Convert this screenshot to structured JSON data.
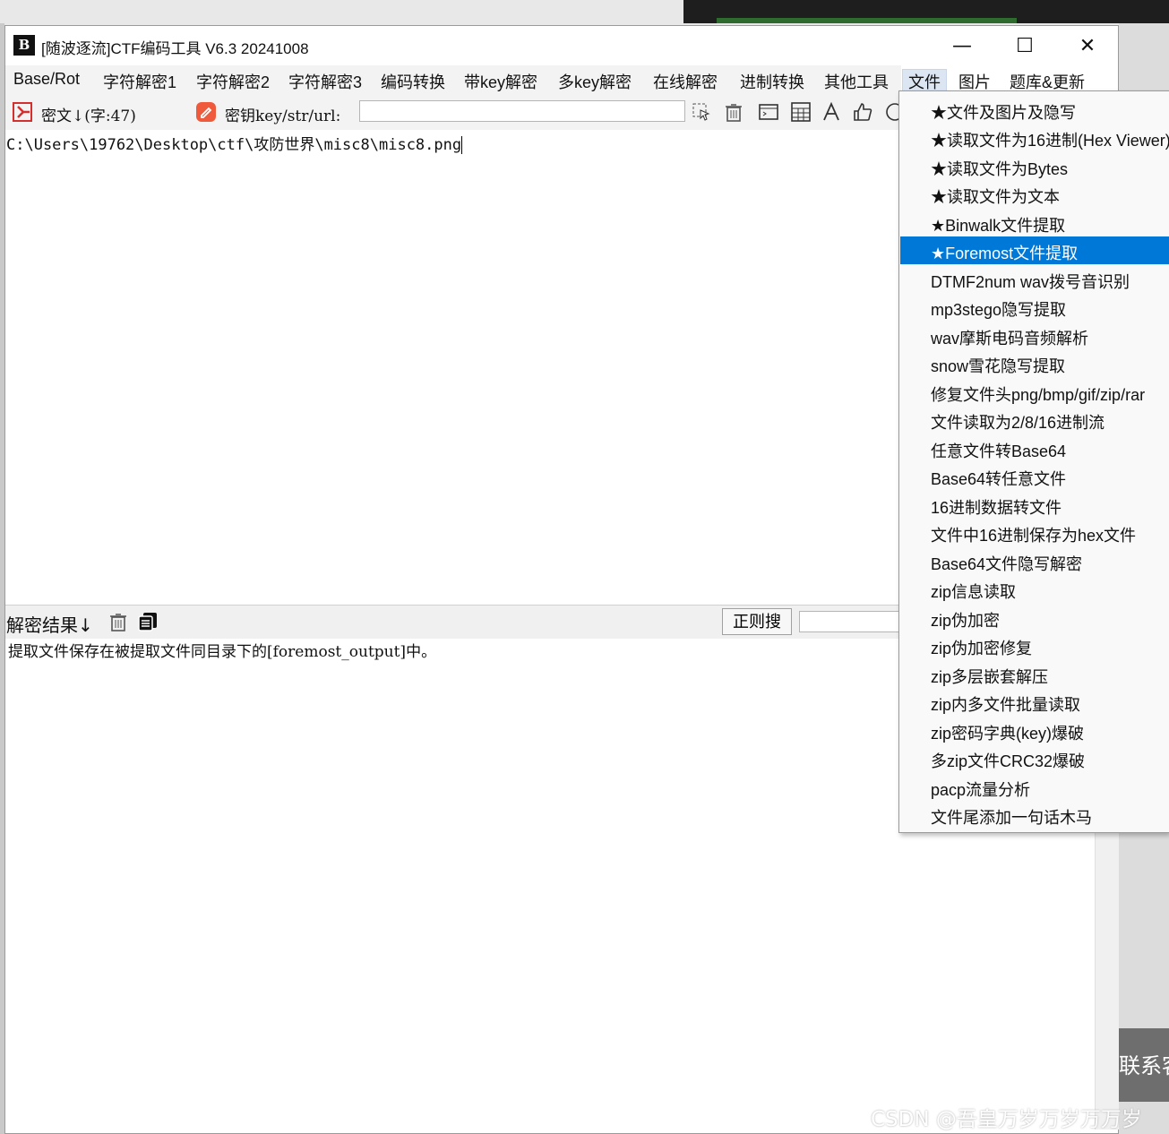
{
  "window": {
    "title": "[随波逐流]CTF编码工具 V6.3 20241008",
    "app_icon": "B",
    "controls": {
      "minimize": "—",
      "maximize": "☐",
      "close": "✕"
    }
  },
  "menubar": {
    "items": [
      "Base/Rot",
      "字符解密1",
      "字符解密2",
      "字符解密3",
      "编码转换",
      "带key解密",
      "多key解密",
      "在线解密",
      "进制转换",
      "其他工具",
      "文件",
      "图片",
      "题库&更新"
    ],
    "active_index": 10
  },
  "toolbar": {
    "cipher_label": "密文↓(字:47)",
    "key_label": "密钥key/str/url:",
    "key_value": ""
  },
  "cipher": {
    "text": "C:\\Users\\19762\\Desktop\\ctf\\攻防世界\\misc8\\misc8.png"
  },
  "result": {
    "label": "解密结果↓",
    "regex_button": "正则搜",
    "regex_value": "",
    "text": "提取文件保存在被提取文件同目录下的[foremost_output]中。"
  },
  "file_menu": {
    "items": [
      "★文件及图片及隐写",
      "★读取文件为16进制(Hex Viewer)",
      "★读取文件为Bytes",
      "★读取文件为文本",
      "★Binwalk文件提取",
      "★Foremost文件提取",
      "DTMF2num  wav拨号音识别",
      "mp3stego隐写提取",
      "wav摩斯电码音频解析",
      "snow雪花隐写提取",
      "修复文件头png/bmp/gif/zip/rar",
      "文件读取为2/8/16进制流",
      "任意文件转Base64",
      "Base64转任意文件",
      "16进制数据转文件",
      "文件中16进制保存为hex文件",
      "Base64文件隐写解密",
      "zip信息读取",
      "zip伪加密",
      "zip伪加密修复",
      "zip多层嵌套解压",
      "zip内多文件批量读取",
      "zip密码字典(key)爆破",
      "多zip文件CRC32爆破",
      "pacp流量分析",
      "文件尾添加一句话木马"
    ],
    "selected_index": 5
  },
  "background": {
    "side_text": "联系客",
    "watermark": "CSDN @吾皇万岁万岁万万岁"
  },
  "colors": {
    "selection": "#0078d7",
    "menu_active": "#dce6f3"
  }
}
